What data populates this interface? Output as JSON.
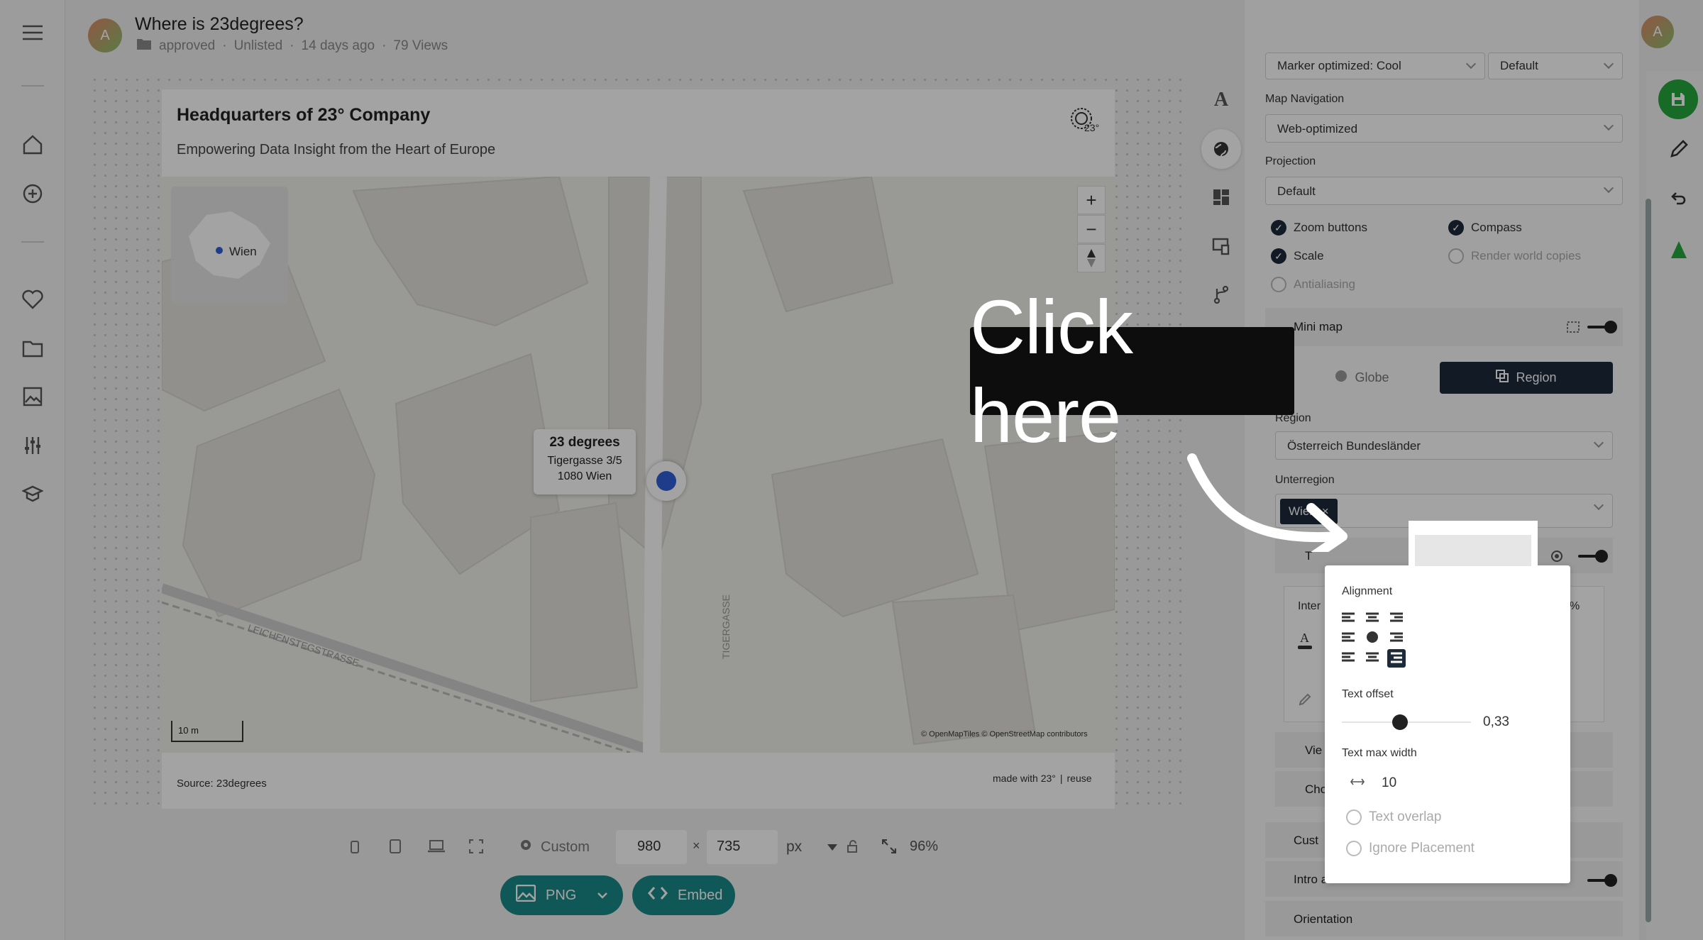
{
  "header": {
    "avatar_letter": "A",
    "title": "Where is 23degrees?",
    "folder": "approved",
    "visibility": "Unlisted",
    "age": "14 days ago",
    "views": "79 Views"
  },
  "card": {
    "title": "Headquarters of 23° Company",
    "subtitle": "Empowering Data Insight from the Heart of Europe",
    "source": "Source: 23degrees",
    "made_with": "made with 23°",
    "reuse": "reuse"
  },
  "map": {
    "minimap_label": "Wien",
    "scale": "10 m",
    "attribution": "© OpenMapTiles © OpenStreetMap contributors",
    "street_1": "LEICHENSTEGSTRASSE",
    "street_2": "TIGERGASSE",
    "tooltip": {
      "name": "23 degrees",
      "line1": "Tigergasse 3/5",
      "line2": "1080 Wien"
    },
    "zoom_in": "+",
    "zoom_out": "−"
  },
  "bottom": {
    "preset": "Custom",
    "width": "980",
    "times": "×",
    "height": "735",
    "unit": "px",
    "zoom": "96%",
    "png_label": "PNG",
    "embed_label": "Embed"
  },
  "panel": {
    "marker_style": "Marker optimized: Cool",
    "marker_default": "Default",
    "map_navigation_label": "Map Navigation",
    "map_navigation_value": "Web-optimized",
    "projection_label": "Projection",
    "projection_value": "Default",
    "checks": {
      "zoom_buttons": "Zoom buttons",
      "compass": "Compass",
      "scale": "Scale",
      "render_world_copies": "Render world copies",
      "antialiasing": "Antialiasing"
    },
    "minimap_section": "Mini map",
    "tab_globe": "Globe",
    "tab_region": "Region",
    "region_label": "Region",
    "region_value": "Österreich Bundesländer",
    "subregion_label": "Unterregion",
    "subregion_chip": "Wien",
    "text_section": "T",
    "inter_label": "Inter",
    "percent": "%",
    "view_section": "Vie",
    "cho_section": "Cho",
    "cust_section": "Cust",
    "intro_section": "Intro animation",
    "orientation_section": "Orientation"
  },
  "popover": {
    "alignment_label": "Alignment",
    "text_offset_label": "Text offset",
    "text_offset_value": "0,33",
    "text_offset_fraction": 0.33,
    "text_max_width_label": "Text max width",
    "text_max_width_value": "10",
    "text_overlap": "Text overlap",
    "ignore_placement": "Ignore Placement"
  },
  "overlay": {
    "click_label": "Click here"
  },
  "colors": {
    "accent_teal": "#1a8a8a",
    "save_green": "#27a83c",
    "marker_blue": "#2f5fd6",
    "region_dark": "#1d2a3a"
  }
}
